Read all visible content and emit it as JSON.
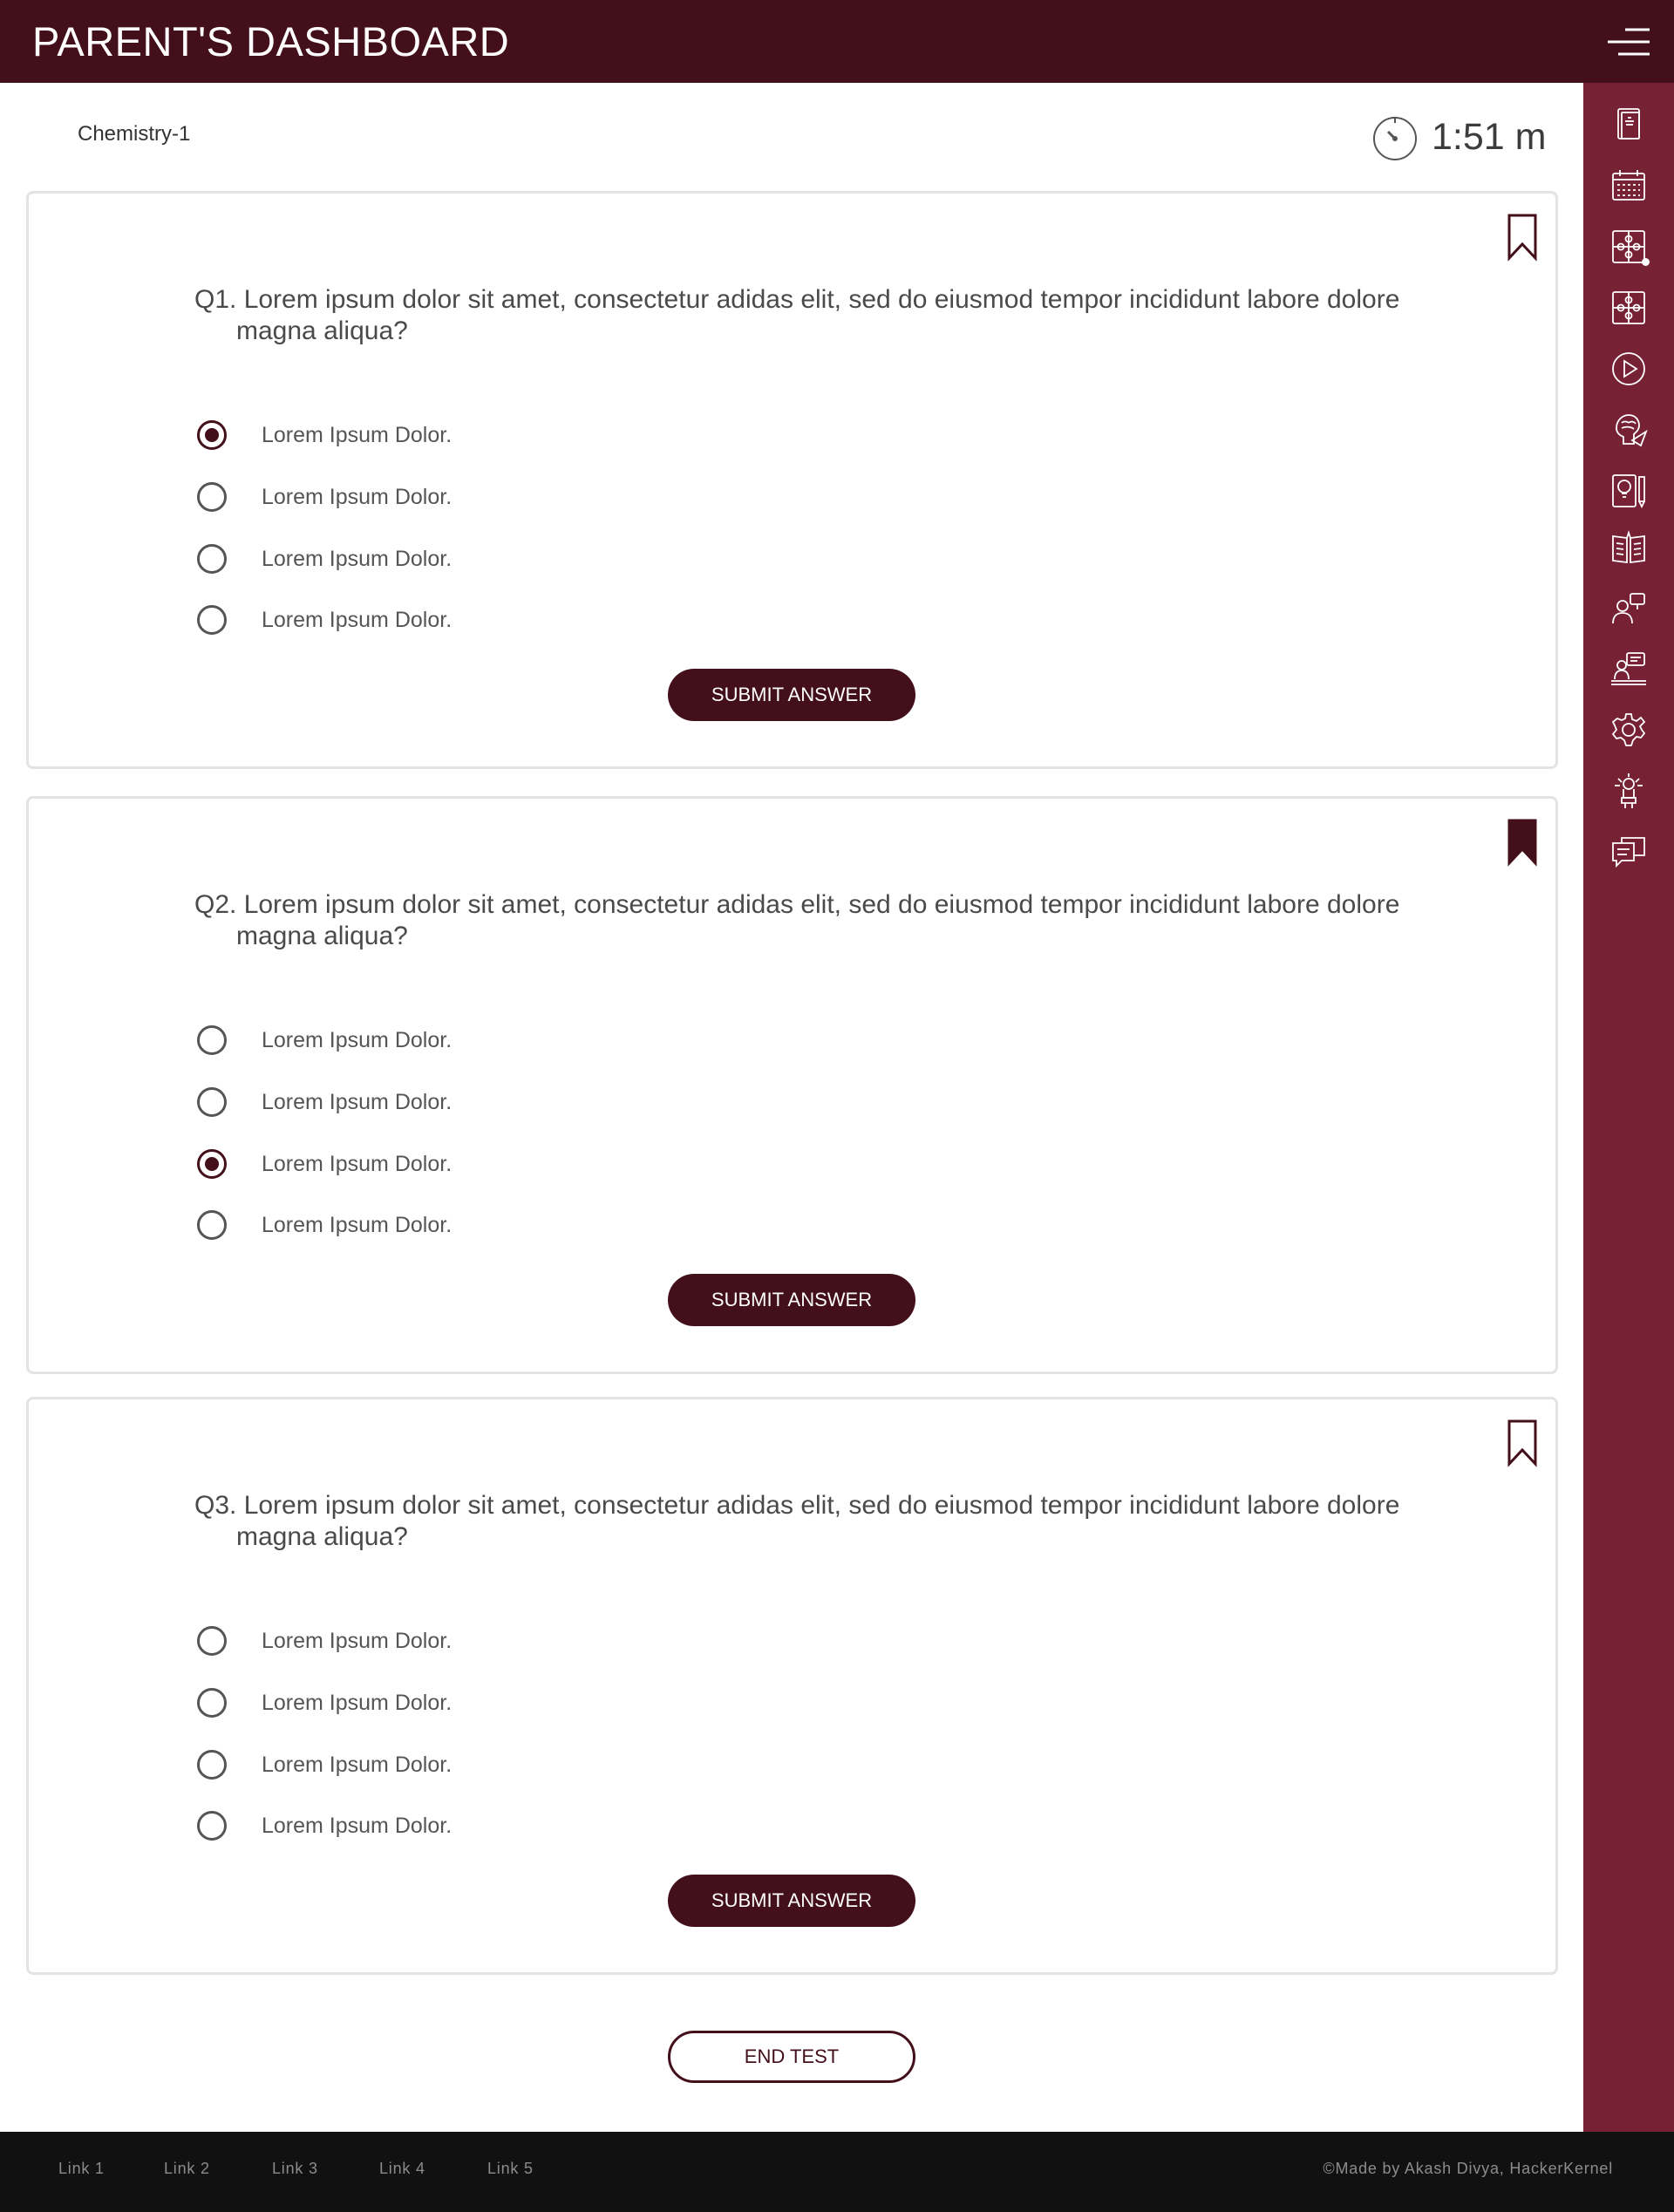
{
  "header": {
    "title": "PARENT'S DASHBOARD",
    "menu_icon": "hamburger-menu-icon"
  },
  "test": {
    "subject": "Chemistry-1",
    "timer": "1:51 m",
    "timer_icon": "stopwatch-icon"
  },
  "questions": [
    {
      "text": "Q1. Lorem ipsum dolor sit amet, consectetur adidas elit, sed do eiusmod tempor incididunt labore dolore magna aliqua?",
      "bookmarked": false,
      "options": [
        "Lorem Ipsum Dolor.",
        "Lorem Ipsum Dolor.",
        "Lorem Ipsum Dolor.",
        "Lorem Ipsum Dolor."
      ],
      "selected_option": 1,
      "submit_label": "SUBMIT ANSWER"
    },
    {
      "text": "Q2. Lorem ipsum dolor sit amet, consectetur adidas elit, sed do eiusmod tempor incididunt labore dolore magna aliqua?",
      "bookmarked": true,
      "options": [
        "Lorem Ipsum Dolor.",
        "Lorem Ipsum Dolor.",
        "Lorem Ipsum Dolor.",
        "Lorem Ipsum Dolor."
      ],
      "selected_option": 3,
      "submit_label": "SUBMIT ANSWER"
    },
    {
      "text": "Q3. Lorem ipsum dolor sit amet, consectetur adidas elit, sed do eiusmod tempor incididunt labore dolore magna aliqua?",
      "bookmarked": false,
      "options": [
        "Lorem Ipsum Dolor.",
        "Lorem Ipsum Dolor.",
        "Lorem Ipsum Dolor.",
        "Lorem Ipsum Dolor."
      ],
      "selected_option": null,
      "submit_label": "SUBMIT ANSWER"
    }
  ],
  "end_test_label": "END TEST",
  "sidebar": {
    "items": [
      {
        "icon": "book-icon"
      },
      {
        "icon": "calendar-icon"
      },
      {
        "icon": "puzzle-icon",
        "active": true
      },
      {
        "icon": "puzzle-icon"
      },
      {
        "icon": "play-icon"
      },
      {
        "icon": "brain-rocket-icon"
      },
      {
        "icon": "ideas-notebook-icon"
      },
      {
        "icon": "open-book-icon"
      },
      {
        "icon": "teacher-icon"
      },
      {
        "icon": "classroom-icon"
      },
      {
        "icon": "gear-icon"
      },
      {
        "icon": "award-icon"
      },
      {
        "icon": "chat-icon"
      }
    ]
  },
  "footer": {
    "links": [
      "Link 1",
      "Link 2",
      "Link 3",
      "Link 4",
      "Link 5"
    ],
    "credit": "©Made by Akash Divya, HackerKernel"
  },
  "colors": {
    "header": "#420f1a",
    "sidebar": "#772135",
    "accent": "#420f1a",
    "footer": "#111111"
  }
}
